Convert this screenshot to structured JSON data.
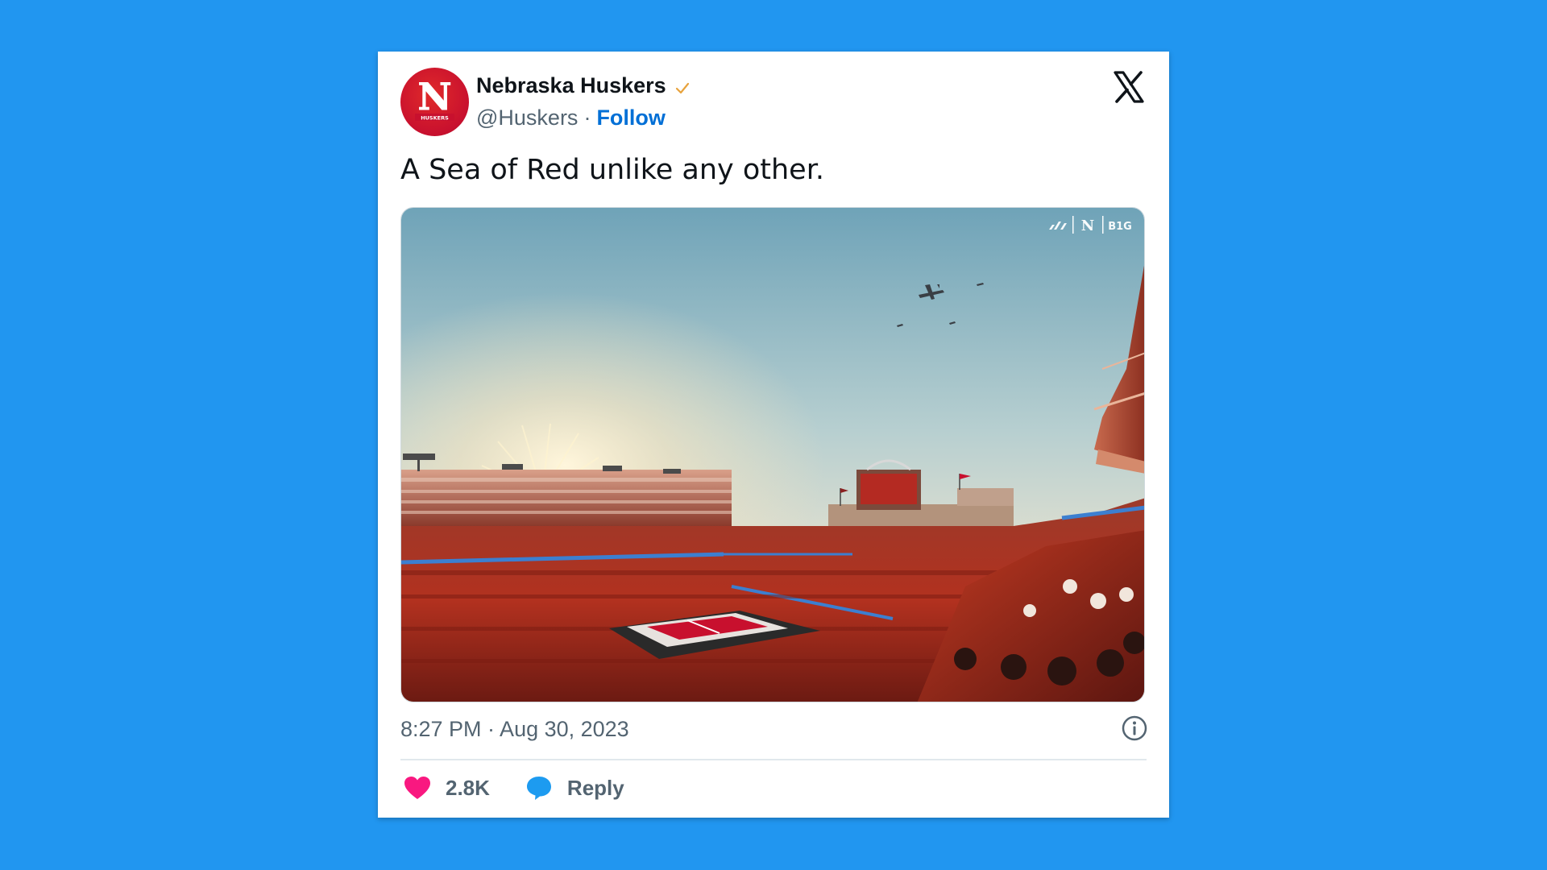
{
  "author": {
    "name": "Nebraska Huskers",
    "handle": "@Huskers",
    "separator": "·",
    "follow_label": "Follow",
    "avatar_text": "HUSKERS",
    "avatar_letter": "N"
  },
  "tweet": {
    "text": "A Sea of Red unlike any other.",
    "timestamp": "8:27 PM · Aug 30, 2023"
  },
  "actions": {
    "like_count": "2.8K",
    "reply_label": "Reply"
  },
  "media": {
    "watermark_left": "N",
    "watermark_right": "B1G"
  },
  "colors": {
    "page_background": "#2196f0",
    "like_heart": "#f91880",
    "reply_bubble": "#1d9bf0",
    "follow_link": "#006fd6",
    "brand_red": "#c8102e"
  },
  "icons": {
    "verified": "checkmark-icon",
    "platform": "x-logo-icon",
    "info": "info-icon",
    "like": "heart-icon",
    "reply": "speech-bubble-icon"
  }
}
